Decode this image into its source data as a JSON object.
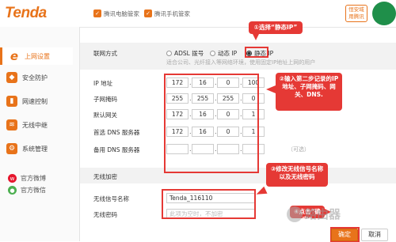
{
  "header": {
    "logo": "Tenda",
    "links": [
      "腾讯电脑管家",
      "腾讯手机管家"
    ],
    "app_badge": [
      "恒安域",
      "用腾讯"
    ]
  },
  "sidebar": {
    "items": [
      {
        "label": "上网设置",
        "icon": "internet-e-icon",
        "active": true
      },
      {
        "label": "安全防护",
        "icon": "shield-icon"
      },
      {
        "label": "网速控制",
        "icon": "speed-icon"
      },
      {
        "label": "无线中继",
        "icon": "wireless-relay-icon"
      },
      {
        "label": "系统管理",
        "icon": "gear-icon"
      }
    ],
    "social": [
      {
        "label": "官方微博",
        "icon": "weibo-icon",
        "color": "#e6162d"
      },
      {
        "label": "官方微信",
        "icon": "wechat-icon",
        "color": "#4caf50"
      }
    ]
  },
  "connection": {
    "label": "联网方式",
    "options": [
      "ADSL 拨号",
      "动态 IP",
      "静态 IP"
    ],
    "selected": "静态 IP",
    "hint": "适合公司、光纤接入等网络环境，使用固定IP地址上网的用户"
  },
  "fields": [
    {
      "label": "IP 地址",
      "octets": [
        "172",
        "16",
        "0",
        "100"
      ]
    },
    {
      "label": "子网掩码",
      "octets": [
        "255",
        "255",
        "255",
        "0"
      ]
    },
    {
      "label": "默认网关",
      "octets": [
        "172",
        "16",
        "0",
        "1"
      ]
    },
    {
      "label": "首选 DNS 服务器",
      "octets": [
        "172",
        "16",
        "0",
        "1"
      ]
    },
    {
      "label": "备用 DNS 服务器",
      "octets": [
        "",
        "",
        "",
        ""
      ],
      "hint": "（可选）"
    }
  ],
  "wireless": {
    "section_title": "无线加密",
    "ssid_label": "无线信号名称",
    "ssid_value": "Tenda_116110",
    "password_label": "无线密码",
    "password_placeholder": "此项为空时，不加密"
  },
  "callouts": {
    "c1": "①选择“静态IP”",
    "c2": "②输入第二步记录的IP地址、子网掩码、网关、DNS.",
    "c3": "③修改无线信号名称以及无线密码",
    "c4": "④点击“确定”"
  },
  "buttons": {
    "ok": "确定",
    "cancel": "取消"
  },
  "watermark": "路由器",
  "colors": {
    "accent": "#e8731a",
    "annotation": "#e53935"
  }
}
